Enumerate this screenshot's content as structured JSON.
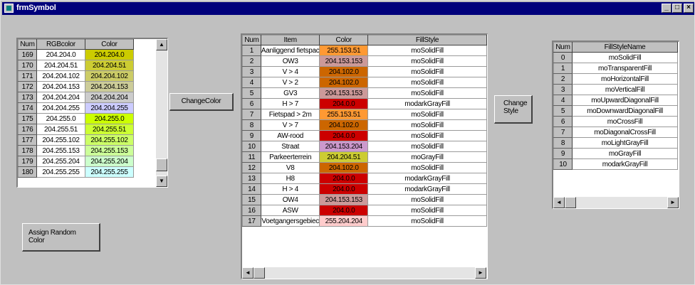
{
  "window": {
    "title": "frmSymbol",
    "minimize_label": "_",
    "maximize_label": "□",
    "close_label": "×"
  },
  "rgb_grid": {
    "headers": [
      "Num",
      "RGBcolor",
      "Color"
    ],
    "rows": [
      {
        "num": "169",
        "rgb": "204.204.0",
        "color_text": "204.204.0",
        "bg": "#cccc00"
      },
      {
        "num": "170",
        "rgb": "204.204.51",
        "color_text": "204.204.51",
        "bg": "#cccc33"
      },
      {
        "num": "171",
        "rgb": "204.204.102",
        "color_text": "204.204.102",
        "bg": "#cccc66"
      },
      {
        "num": "172",
        "rgb": "204.204.153",
        "color_text": "204.204.153",
        "bg": "#cccc99"
      },
      {
        "num": "173",
        "rgb": "204.204.204",
        "color_text": "204.204.204",
        "bg": "#cccccc"
      },
      {
        "num": "174",
        "rgb": "204.204.255",
        "color_text": "204.204.255",
        "bg": "#ccccff"
      },
      {
        "num": "175",
        "rgb": "204.255.0",
        "color_text": "204.255.0",
        "bg": "#ccff00"
      },
      {
        "num": "176",
        "rgb": "204.255.51",
        "color_text": "204.255.51",
        "bg": "#ccff33"
      },
      {
        "num": "177",
        "rgb": "204.255.102",
        "color_text": "204.255.102",
        "bg": "#ccff66"
      },
      {
        "num": "178",
        "rgb": "204.255.153",
        "color_text": "204.255.153",
        "bg": "#ccff99"
      },
      {
        "num": "179",
        "rgb": "204.255.204",
        "color_text": "204.255.204",
        "bg": "#ccffcc"
      },
      {
        "num": "180",
        "rgb": "204.255.255",
        "color_text": "204.255.255",
        "bg": "#ccffff"
      }
    ]
  },
  "buttons": {
    "change_color": "ChangeColor",
    "change_style_line1": "Change",
    "change_style_line2": "Style",
    "assign_random_line1": "Assign Random",
    "assign_random_line2": "Color"
  },
  "item_grid": {
    "headers": [
      "Num",
      "Item",
      "Color",
      "FillStyle"
    ],
    "rows": [
      {
        "num": "1",
        "item": "Aanliggend fietspac",
        "color_text": "255.153.51",
        "bg": "#ff9933",
        "style": "moSolidFill"
      },
      {
        "num": "2",
        "item": "OW3",
        "color_text": "204.153.153",
        "bg": "#cc9999",
        "style": "moSolidFill"
      },
      {
        "num": "3",
        "item": "V > 4",
        "color_text": "204.102.0",
        "bg": "#cc6600",
        "style": "moSolidFill"
      },
      {
        "num": "4",
        "item": "V > 2",
        "color_text": "204.102.0",
        "bg": "#cc6600",
        "style": "moSolidFill"
      },
      {
        "num": "5",
        "item": "GV3",
        "color_text": "204.153.153",
        "bg": "#cc9999",
        "style": "moSolidFill"
      },
      {
        "num": "6",
        "item": "H > 7",
        "color_text": "204.0.0",
        "bg": "#cc0000",
        "style": "modarkGrayFill"
      },
      {
        "num": "7",
        "item": "Fietspad > 2m",
        "color_text": "255.153.51",
        "bg": "#ff9933",
        "style": "moSolidFill"
      },
      {
        "num": "8",
        "item": "V > 7",
        "color_text": "204.102.0",
        "bg": "#cc6600",
        "style": "moSolidFill"
      },
      {
        "num": "9",
        "item": "AW-rood",
        "color_text": "204.0.0",
        "bg": "#cc0000",
        "style": "moSolidFill"
      },
      {
        "num": "10",
        "item": "Straat",
        "color_text": "204.153.204",
        "bg": "#cc99cc",
        "style": "moSolidFill"
      },
      {
        "num": "11",
        "item": "Parkeerterrein",
        "color_text": "204.204.51",
        "bg": "#cccc33",
        "style": "moGrayFill"
      },
      {
        "num": "12",
        "item": "V8",
        "color_text": "204.102.0",
        "bg": "#cc6600",
        "style": "moSolidFill"
      },
      {
        "num": "13",
        "item": "H8",
        "color_text": "204.0.0",
        "bg": "#cc0000",
        "style": "modarkGrayFill"
      },
      {
        "num": "14",
        "item": "H > 4",
        "color_text": "204.0.0",
        "bg": "#cc0000",
        "style": "modarkGrayFill"
      },
      {
        "num": "15",
        "item": "OW4",
        "color_text": "204.153.153",
        "bg": "#cc9999",
        "style": "moSolidFill"
      },
      {
        "num": "16",
        "item": "ASW",
        "color_text": "204.0.0",
        "bg": "#cc0000",
        "style": "moSolidFill"
      },
      {
        "num": "17",
        "item": "Voetgangersgebiec",
        "color_text": "255.204.204",
        "bg": "#ffcccc",
        "style": "moSolidFill"
      }
    ]
  },
  "style_grid": {
    "headers": [
      "Num",
      "FillStyleName"
    ],
    "rows": [
      {
        "num": "0",
        "name": "moSolidFill"
      },
      {
        "num": "1",
        "name": "moTransparentFill"
      },
      {
        "num": "2",
        "name": "moHorizontalFill"
      },
      {
        "num": "3",
        "name": "moVerticalFill"
      },
      {
        "num": "4",
        "name": "moUpwardDiagonalFill"
      },
      {
        "num": "5",
        "name": "moDownwardDiagonalFill"
      },
      {
        "num": "6",
        "name": "moCrossFill"
      },
      {
        "num": "7",
        "name": "moDiagonalCrossFill"
      },
      {
        "num": "8",
        "name": "moLightGrayFill"
      },
      {
        "num": "9",
        "name": "moGrayFill"
      },
      {
        "num": "10",
        "name": "modarkGrayFill"
      }
    ]
  }
}
